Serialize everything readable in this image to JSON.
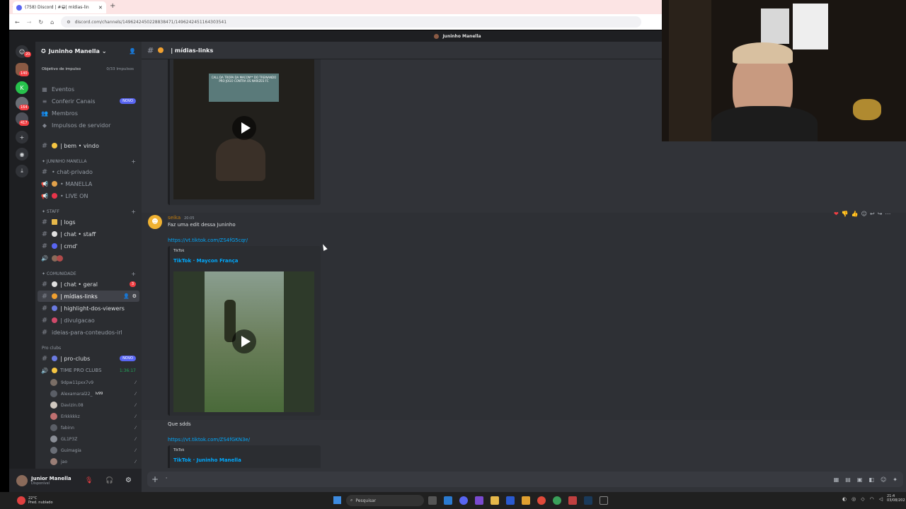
{
  "browser": {
    "tab_title": "(758) Discord | #😀| mídias-lin",
    "url": "discord.com/channels/1496242450228838471/1496242451164303541",
    "new_tab": "+",
    "close": "✕"
  },
  "titlebar": {
    "title": "Juninho Manella"
  },
  "guild_badges": [
    "20",
    "140",
    "164",
    "417"
  ],
  "server": {
    "name": "Juninho Manella",
    "boost_label": "Objetivo de impulso",
    "boost_count": "0/33 Impulsos"
  },
  "menu": [
    {
      "label": "Eventos"
    },
    {
      "label": "Conferir Canais",
      "badge": "NOVO"
    },
    {
      "label": "Membros"
    },
    {
      "label": "Impulsos de servidor"
    }
  ],
  "channels": {
    "bem_vindo": "| bem • vindo",
    "cat1": "✦ JUNINHO MANELLA",
    "chat_privado": "• chat-privado",
    "manella": "• MANELLA",
    "live_on": "• LIVE ON",
    "cat2": "✦ STAFF",
    "logs": "| logs",
    "chat_staff": "| chat • staff",
    "cmd": "| cmd'",
    "cat3": "✦ COMUNIDADE",
    "chat_geral": "| chat • geral",
    "chat_geral_badge": "3",
    "midias": "| mídias-links",
    "highlight": "| highlight-dos-viewers",
    "divulgacao": "| divulgacao",
    "ideias": "ideias-para-conteudos-irl",
    "cat4": "Pro clubs",
    "pro_clubs": "| pro-clubs",
    "pro_clubs_badge": "NOVO",
    "time_pro": "TIME PRO CLUBS",
    "time_pro_timer": "1:36:17"
  },
  "voice_users": [
    "9dpw11pxx7v9",
    "Alexamaral22_",
    "Davizin.08",
    "Erkkkkkz",
    "fabinn",
    "GL1P3Z",
    "Guimagia",
    "jao"
  ],
  "voice_tag": "lv99",
  "user": {
    "name": "Junior Manella",
    "status": "Disponível"
  },
  "header": {
    "channel": "| mídias-links"
  },
  "messages": {
    "video1_text": "CALL DA TROPA DA MACON** DO TREINANDO PRO JOGO CONTRA OS NARIZES FC",
    "author": "seika",
    "time": "20:05",
    "text1": "Faz uma edit dessa Juninho",
    "link1": "https://vt.tiktok.com/ZS4fG5cqr/",
    "embed1_provider": "TikTok",
    "embed1_title": "TikTok · Maycon França",
    "text2": "Que sdds",
    "link2": "https://vt.tiktok.com/ZS4fGKN3e/",
    "embed2_provider": "TikTok",
    "embed2_title": "TikTok · Juninho Manella"
  },
  "taskbar": {
    "temp": "22°C",
    "weather": "Pred. nublado",
    "search": "Pesquisar",
    "time": "21:4",
    "date": "03/08/202"
  },
  "colors": {
    "blurple": "#5865f2",
    "link": "#00a8fc",
    "author": "#c27c0e",
    "badge": "#f23f43"
  }
}
